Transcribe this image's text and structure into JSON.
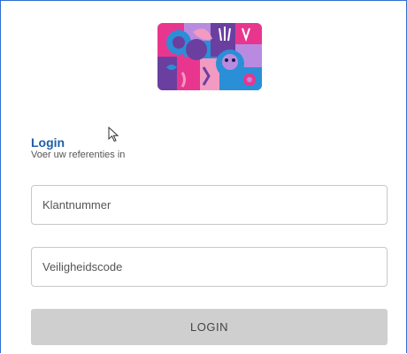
{
  "login": {
    "title": "Login",
    "subtitle": "Voer uw referenties in"
  },
  "form": {
    "customer_number_placeholder": "Klantnummer",
    "security_code_placeholder": "Veiligheidscode",
    "submit_label": "LOGIN"
  },
  "colors": {
    "accent": "#1f5fa8",
    "frame_border": "#2f6fd0",
    "button_bg": "#cfcfcf",
    "logo_pink": "#e8368f",
    "logo_blue": "#2a8fd6",
    "logo_purple": "#6b3fa0",
    "logo_lilac": "#b98be0"
  },
  "icons": {
    "pointer": "mouse-pointer-icon"
  }
}
